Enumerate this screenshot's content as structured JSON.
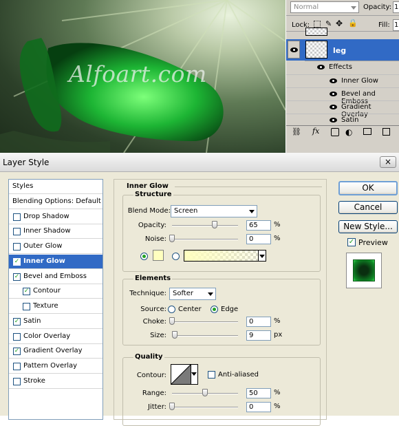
{
  "canvas": {
    "watermark": "Alfoart.com"
  },
  "layers": {
    "blend_mode": "Normal",
    "opacity_label": "Opacity:",
    "opacity_value": "1",
    "lock_label": "Lock:",
    "fill_label": "Fill:",
    "fill_value": "1",
    "layer_name": "leg",
    "effects_label": "Effects",
    "effects": [
      "Inner Glow",
      "Bevel and Emboss",
      "Gradient Overlay",
      "Satin"
    ]
  },
  "dialog": {
    "title": "Layer Style",
    "close": "×",
    "styles": [
      {
        "label": "Styles",
        "check": null,
        "selected": false
      },
      {
        "label": "Blending Options: Default",
        "check": null,
        "selected": false
      },
      {
        "label": "Drop Shadow",
        "check": false,
        "selected": false
      },
      {
        "label": "Inner Shadow",
        "check": false,
        "selected": false
      },
      {
        "label": "Outer Glow",
        "check": false,
        "selected": false
      },
      {
        "label": "Inner Glow",
        "check": true,
        "selected": true
      },
      {
        "label": "Bevel and Emboss",
        "check": true,
        "selected": false
      },
      {
        "label": "Contour",
        "check": true,
        "selected": false,
        "indent": true
      },
      {
        "label": "Texture",
        "check": false,
        "selected": false,
        "indent": true
      },
      {
        "label": "Satin",
        "check": true,
        "selected": false
      },
      {
        "label": "Color Overlay",
        "check": false,
        "selected": false
      },
      {
        "label": "Gradient Overlay",
        "check": true,
        "selected": false
      },
      {
        "label": "Pattern Overlay",
        "check": false,
        "selected": false
      },
      {
        "label": "Stroke",
        "check": false,
        "selected": false
      }
    ],
    "panel_title": "Inner Glow",
    "structure": {
      "title": "Structure",
      "blend_mode_label": "Blend Mode:",
      "blend_mode": "Screen",
      "opacity_label": "Opacity:",
      "opacity": "65",
      "opacity_level": 65,
      "noise_label": "Noise:",
      "noise": "0",
      "noise_level": 0,
      "glow_color": "#ffffbf",
      "percent": "%"
    },
    "elements": {
      "title": "Elements",
      "technique_label": "Technique:",
      "technique": "Softer",
      "source_label": "Source:",
      "center_label": "Center",
      "edge_label": "Edge",
      "choke_label": "Choke:",
      "choke": "0",
      "choke_level": 0,
      "size_label": "Size:",
      "size": "9",
      "size_level": 4,
      "px": "px"
    },
    "quality": {
      "title": "Quality",
      "contour_label": "Contour:",
      "anti_aliased_label": "Anti-aliased",
      "range_label": "Range:",
      "range": "50",
      "range_level": 50,
      "jitter_label": "Jitter:",
      "jitter": "0",
      "jitter_level": 0
    },
    "buttons": {
      "ok": "OK",
      "cancel": "Cancel",
      "new_style": "New Style...",
      "preview_label": "Preview"
    }
  }
}
